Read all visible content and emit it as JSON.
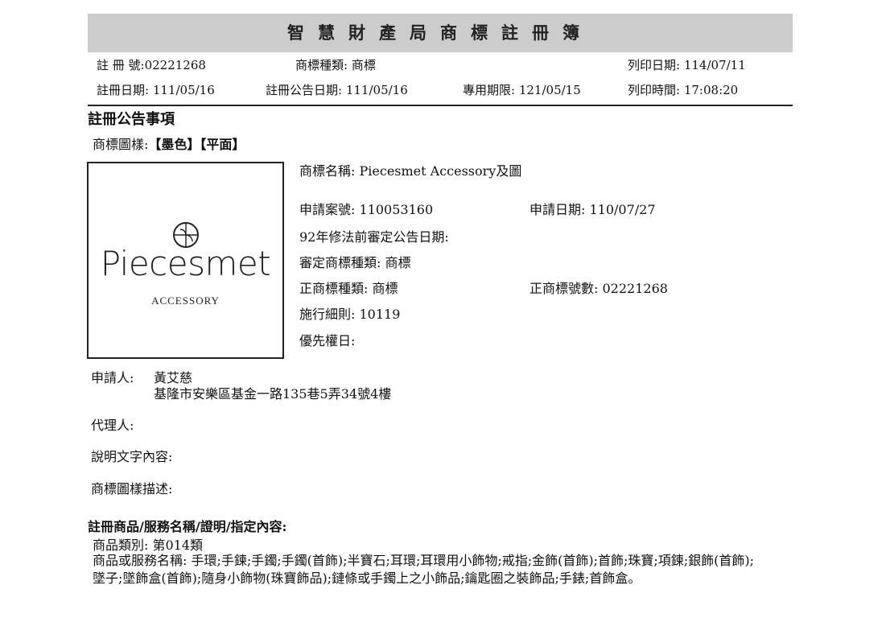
{
  "header": {
    "title": "智慧財產局商標註冊簿",
    "reg_no_label": "註 冊 號:",
    "reg_no": "02221268",
    "type_label": "商標種類:",
    "type": "商標",
    "print_date_label": "列印日期:",
    "print_date": "114/07/11",
    "reg_date_label": "註冊日期:",
    "reg_date": "111/05/16",
    "pub_date_label": "註冊公告日期:",
    "pub_date": "111/05/16",
    "exclusive_label": "專用期限:",
    "exclusive": "121/05/15",
    "print_time_label": "列印時間:",
    "print_time": "17:08:20"
  },
  "section1": {
    "heading": "註冊公告事項",
    "pattern_label": "商標圖樣:",
    "pattern_value": "【墨色】【平面】"
  },
  "logo": {
    "icon": "piecesmet-monogram-icon",
    "word": "Piecesmet",
    "sub": "ACCESSORY"
  },
  "details": {
    "name_label": "商標名稱:",
    "name": "Piecesmet Accessory及圖",
    "app_no_label": "申請案號:",
    "app_no": "110053160",
    "app_date_label": "申請日期:",
    "app_date": "110/07/27",
    "pre92_label": "92年修法前審定公告日期:",
    "approved_type_label": "審定商標種類:",
    "approved_type": "商標",
    "main_type_label": "正商標種類:",
    "main_type": "商標",
    "main_no_label": "正商標號數:",
    "main_no": "02221268",
    "rules_label": "施行細則:",
    "rules": "10119",
    "priority_label": "優先權日:"
  },
  "applicant": {
    "label": "申請人:",
    "name": "黃艾慈",
    "address": "基隆市安樂區基金一路135巷5弄34號4樓"
  },
  "agent_label": "代理人:",
  "desc_label": "說明文字內容:",
  "pattern_desc_label": "商標圖樣描述:",
  "goods": {
    "heading": "註冊商品/服務名稱/證明/指定內容:",
    "class_label": "商品類別:",
    "class": "第014類",
    "items_label": "商品或服務名稱:",
    "items": "手環;手鍊;手鐲;手鐲(首飾);半寶石;耳環;耳環用小飾物;戒指;金飾(首飾);首飾;珠寶;項鍊;銀飾(首飾);墜子;墜飾盒(首飾);隨身小飾物(珠寶飾品);鏈條或手鐲上之小飾品;鑰匙圈之裝飾品;手錶;首飾盒。"
  }
}
